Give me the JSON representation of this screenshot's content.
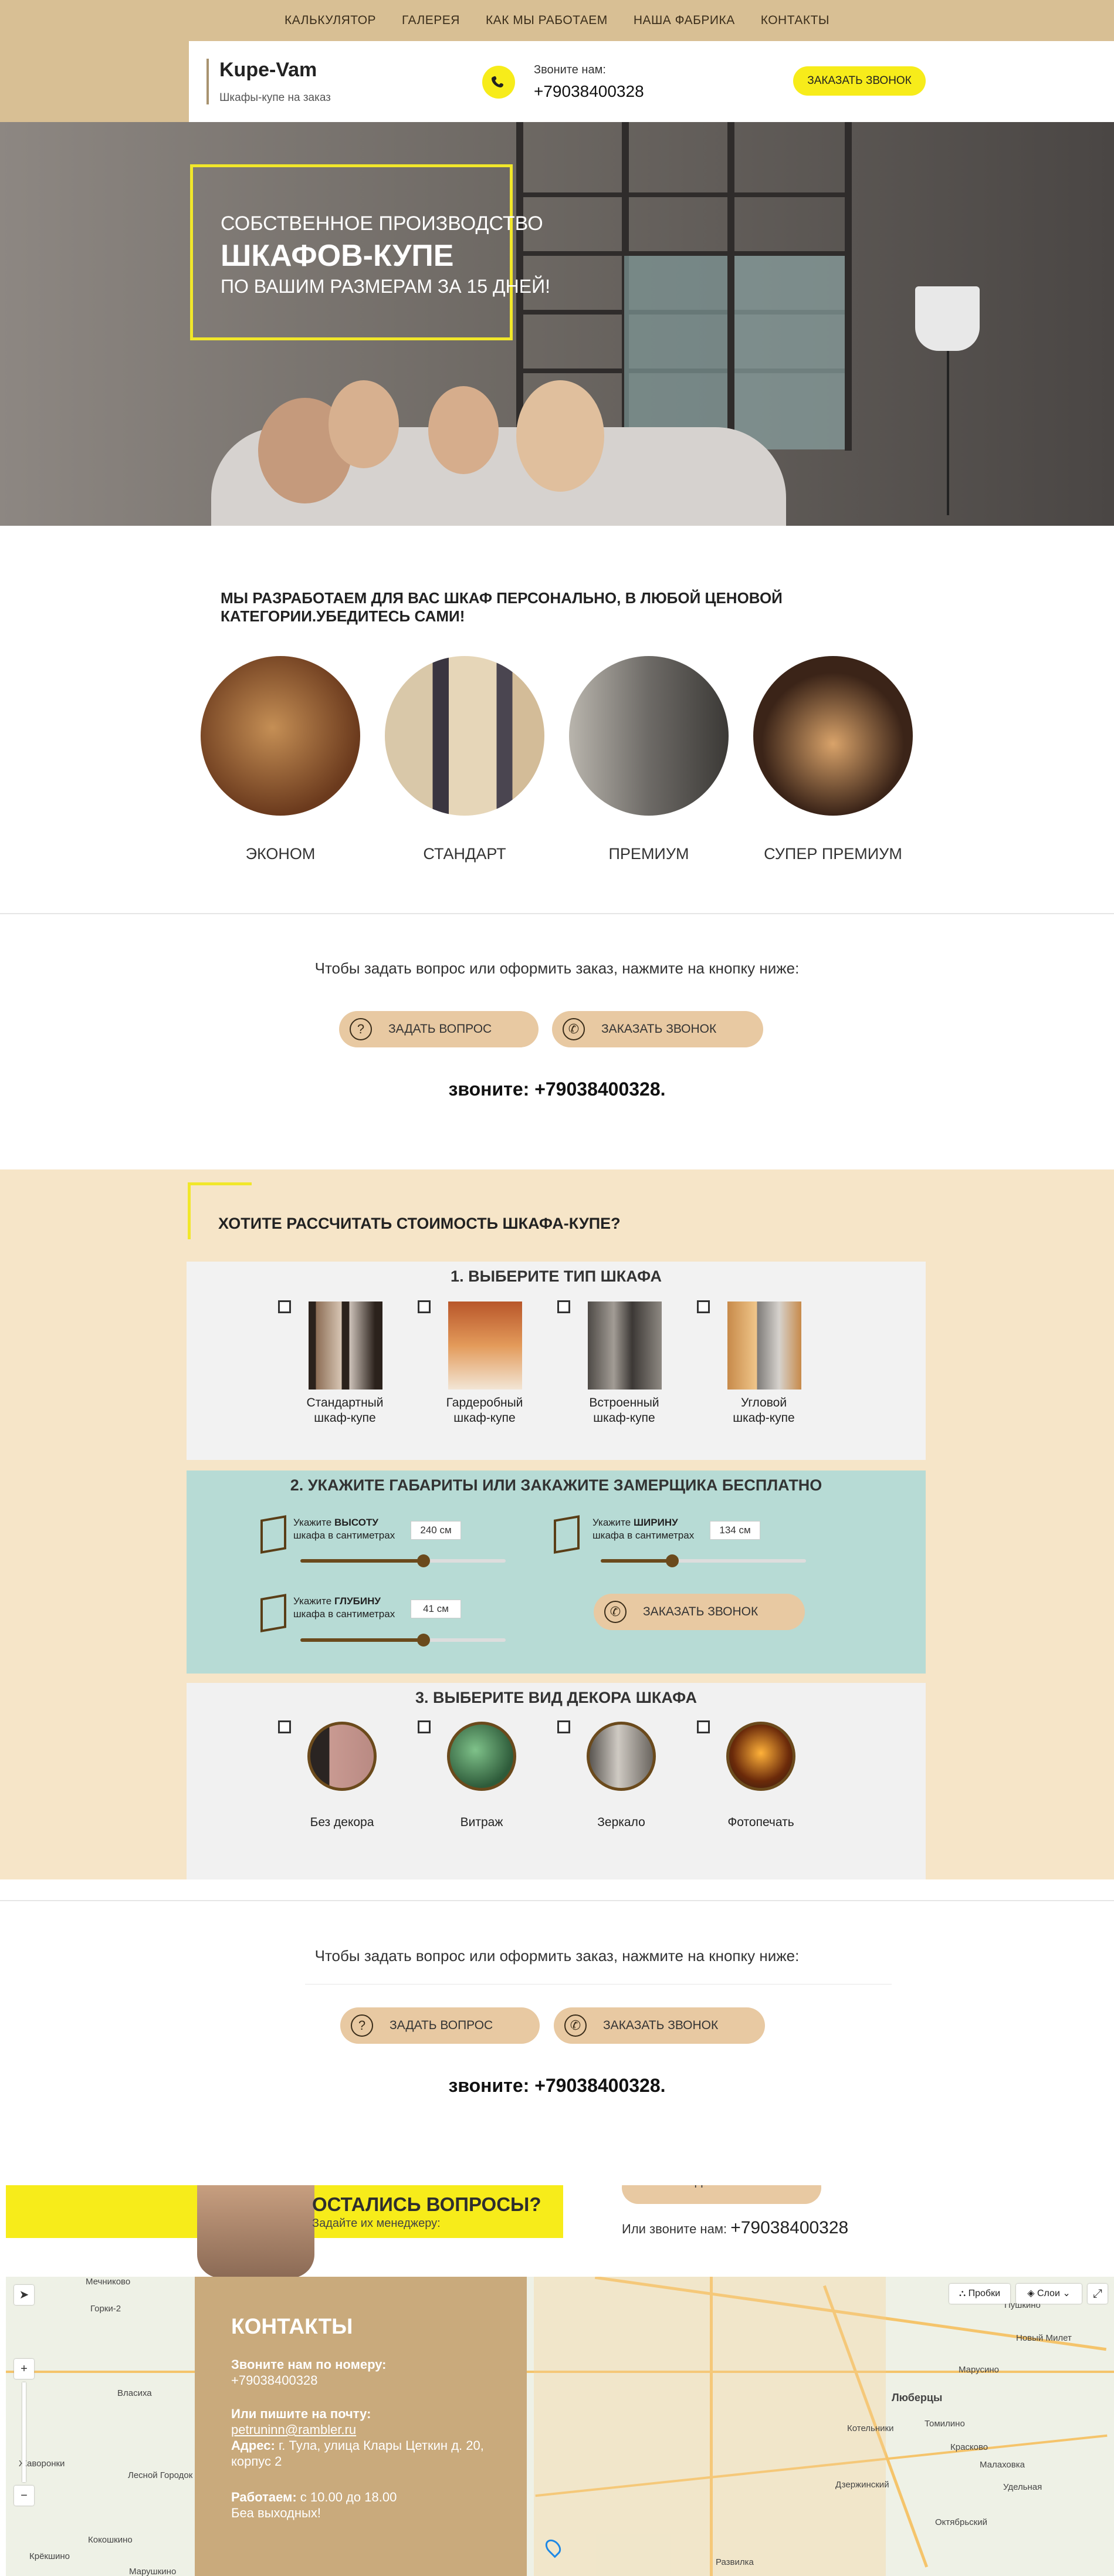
{
  "nav": {
    "items": [
      "КАЛЬКУЛЯТОР",
      "ГАЛЕРЕЯ",
      "КАК МЫ РАБОТАЕМ",
      "НАША ФАБРИКА",
      "КОНТАКТЫ"
    ]
  },
  "header": {
    "logo": "Kupe-Vam",
    "tagline": "Шкафы-купе на заказ",
    "phone_label": "Звоните нам:",
    "phone": "+79038400328",
    "call_button": "ЗАКАЗАТЬ ЗВОНОК"
  },
  "hero": {
    "line1": "СОБСТВЕННОЕ ПРОИЗВОДСТВО",
    "line2": "ШКАФОВ-КУПЕ",
    "line3": "ПО ВАШИМ РАЗМЕРАМ ЗА 15 ДНЕЙ!"
  },
  "categories": {
    "title": "МЫ РАЗРАБОТАЕМ ДЛЯ ВАС ШКАФ ПЕРСОНАЛЬНО, В ЛЮБОЙ ЦЕНОВОЙ КАТЕГОРИИ.УБЕДИТЕСЬ САМИ!",
    "items": [
      "ЭКОНОМ",
      "СТАНДАРТ",
      "ПРЕМИУМ",
      "СУПЕР ПРЕМИУМ"
    ]
  },
  "cta1": {
    "text": "Чтобы задать вопрос или оформить заказ, нажмите на кнопку ниже:",
    "ask_button": "ЗАДАТЬ ВОПРОС",
    "call_button": "ЗАКАЗАТЬ ЗВОНОК",
    "phone_line": "звоните: +79038400328."
  },
  "calculator": {
    "title": "ХОТИТЕ РАССЧИТАТЬ СТОИМОСТЬ ШКАФА-КУПЕ?",
    "step1": {
      "title": "1. ВЫБЕРИТЕ ТИП ШКАФА",
      "options": [
        {
          "line1": "Стандартный",
          "line2": "шкаф-купе"
        },
        {
          "line1": "Гардеробный",
          "line2": "шкаф-купе"
        },
        {
          "line1": "Встроенный",
          "line2": "шкаф-купе"
        },
        {
          "line1": "Угловой",
          "line2": "шкаф-купе"
        }
      ]
    },
    "step2": {
      "title": "2. УКАЖИТЕ ГАБАРИТЫ ИЛИ ЗАКАЖИТЕ ЗАМЕРЩИКА БЕСПЛАТНО",
      "height": {
        "pre": "Укажите",
        "bold": "ВЫСОТУ",
        "line2": "шкафа в сантиметрах",
        "value": "240 см",
        "fraction": 0.6
      },
      "width": {
        "pre": "Укажите",
        "bold": "ШИРИНУ",
        "line2": "шкафа в сантиметрах",
        "value": "134 см",
        "fraction": 0.35
      },
      "depth": {
        "pre": "Укажите",
        "bold": "ГЛУБИНУ",
        "line2": "шкафа в сантиметрах",
        "value": "41 см",
        "fraction": 0.6
      },
      "call_button": "ЗАКАЗАТЬ ЗВОНОК"
    },
    "step3": {
      "title": "3. ВЫБЕРИТЕ ВИД ДЕКОРА ШКАФА",
      "options": [
        "Без декора",
        "Витраж",
        "Зеркало",
        "Фотопечать"
      ]
    }
  },
  "cta2": {
    "text": "Чтобы задать вопрос или оформить заказ, нажмите на кнопку ниже:",
    "ask_button": "ЗАДАТЬ ВОПРОС",
    "call_button": "ЗАКАЗАТЬ ЗВОНОК",
    "phone_line": "звоните: +79038400328."
  },
  "questions": {
    "title": "ОСТАЛИСЬ ВОПРОСЫ?",
    "subtitle": "Задайте их менеджеру:",
    "partial_button": "ЗАДАТЬ ВОПРОС",
    "alt_label": "Или звоните нам:",
    "alt_phone": "+79038400328"
  },
  "contacts": {
    "title": "КОНТАКТЫ",
    "phone_label": "Звоните нам по номеру:",
    "phone": "+79038400328",
    "email_label": "Или пишите на почту:",
    "email": "petruninn@rambler.ru",
    "address_label": "Адрес:",
    "address_line1": "г. Тула, улица Клары Цеткин д. 20,",
    "address_line2": "корпус 2",
    "hours_label": "Работаем:",
    "hours_value": "с 10.00 до 18.00",
    "weekend": "Беа выходных!"
  },
  "map": {
    "traffic_button": "Пробки",
    "layers_button": "Слои",
    "labels": [
      "Мечниково",
      "Горки-2",
      "Власиха",
      "Лесной Городок",
      "Кокошкино",
      "Марушкино",
      "Крёкшино",
      "Люберцы",
      "Котельники",
      "Томилино",
      "Красково",
      "Малаховка",
      "Дзержинский",
      "Удельная",
      "Октябрьский",
      "Развилка",
      "Пушкино",
      "Новый Милет",
      "Марусино",
      "Жаворонки"
    ]
  }
}
